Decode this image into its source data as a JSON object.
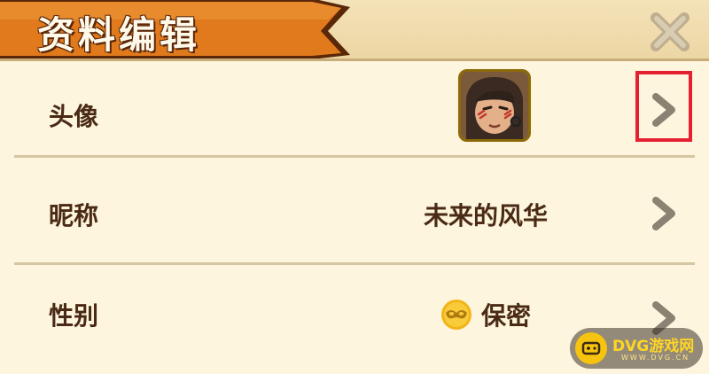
{
  "dialog": {
    "title": "资料编辑",
    "close_icon": "close-x-icon"
  },
  "rows": [
    {
      "label": "头像",
      "value_type": "avatar",
      "icon": "avatar-portrait-icon"
    },
    {
      "label": "昵称",
      "value": "未来的风华"
    },
    {
      "label": "性别",
      "value": "保密",
      "icon": "mask-icon"
    }
  ],
  "highlight": {
    "row": "头像",
    "color": "#e52131"
  },
  "watermark": {
    "text": "DVG游戏网",
    "sub": "WWW.DVG.CN"
  },
  "colors": {
    "ribbon": "#e07a1c",
    "panel_bg": "#fdf5dd",
    "text": "#4a2a16",
    "chevron": "#8a8272"
  }
}
